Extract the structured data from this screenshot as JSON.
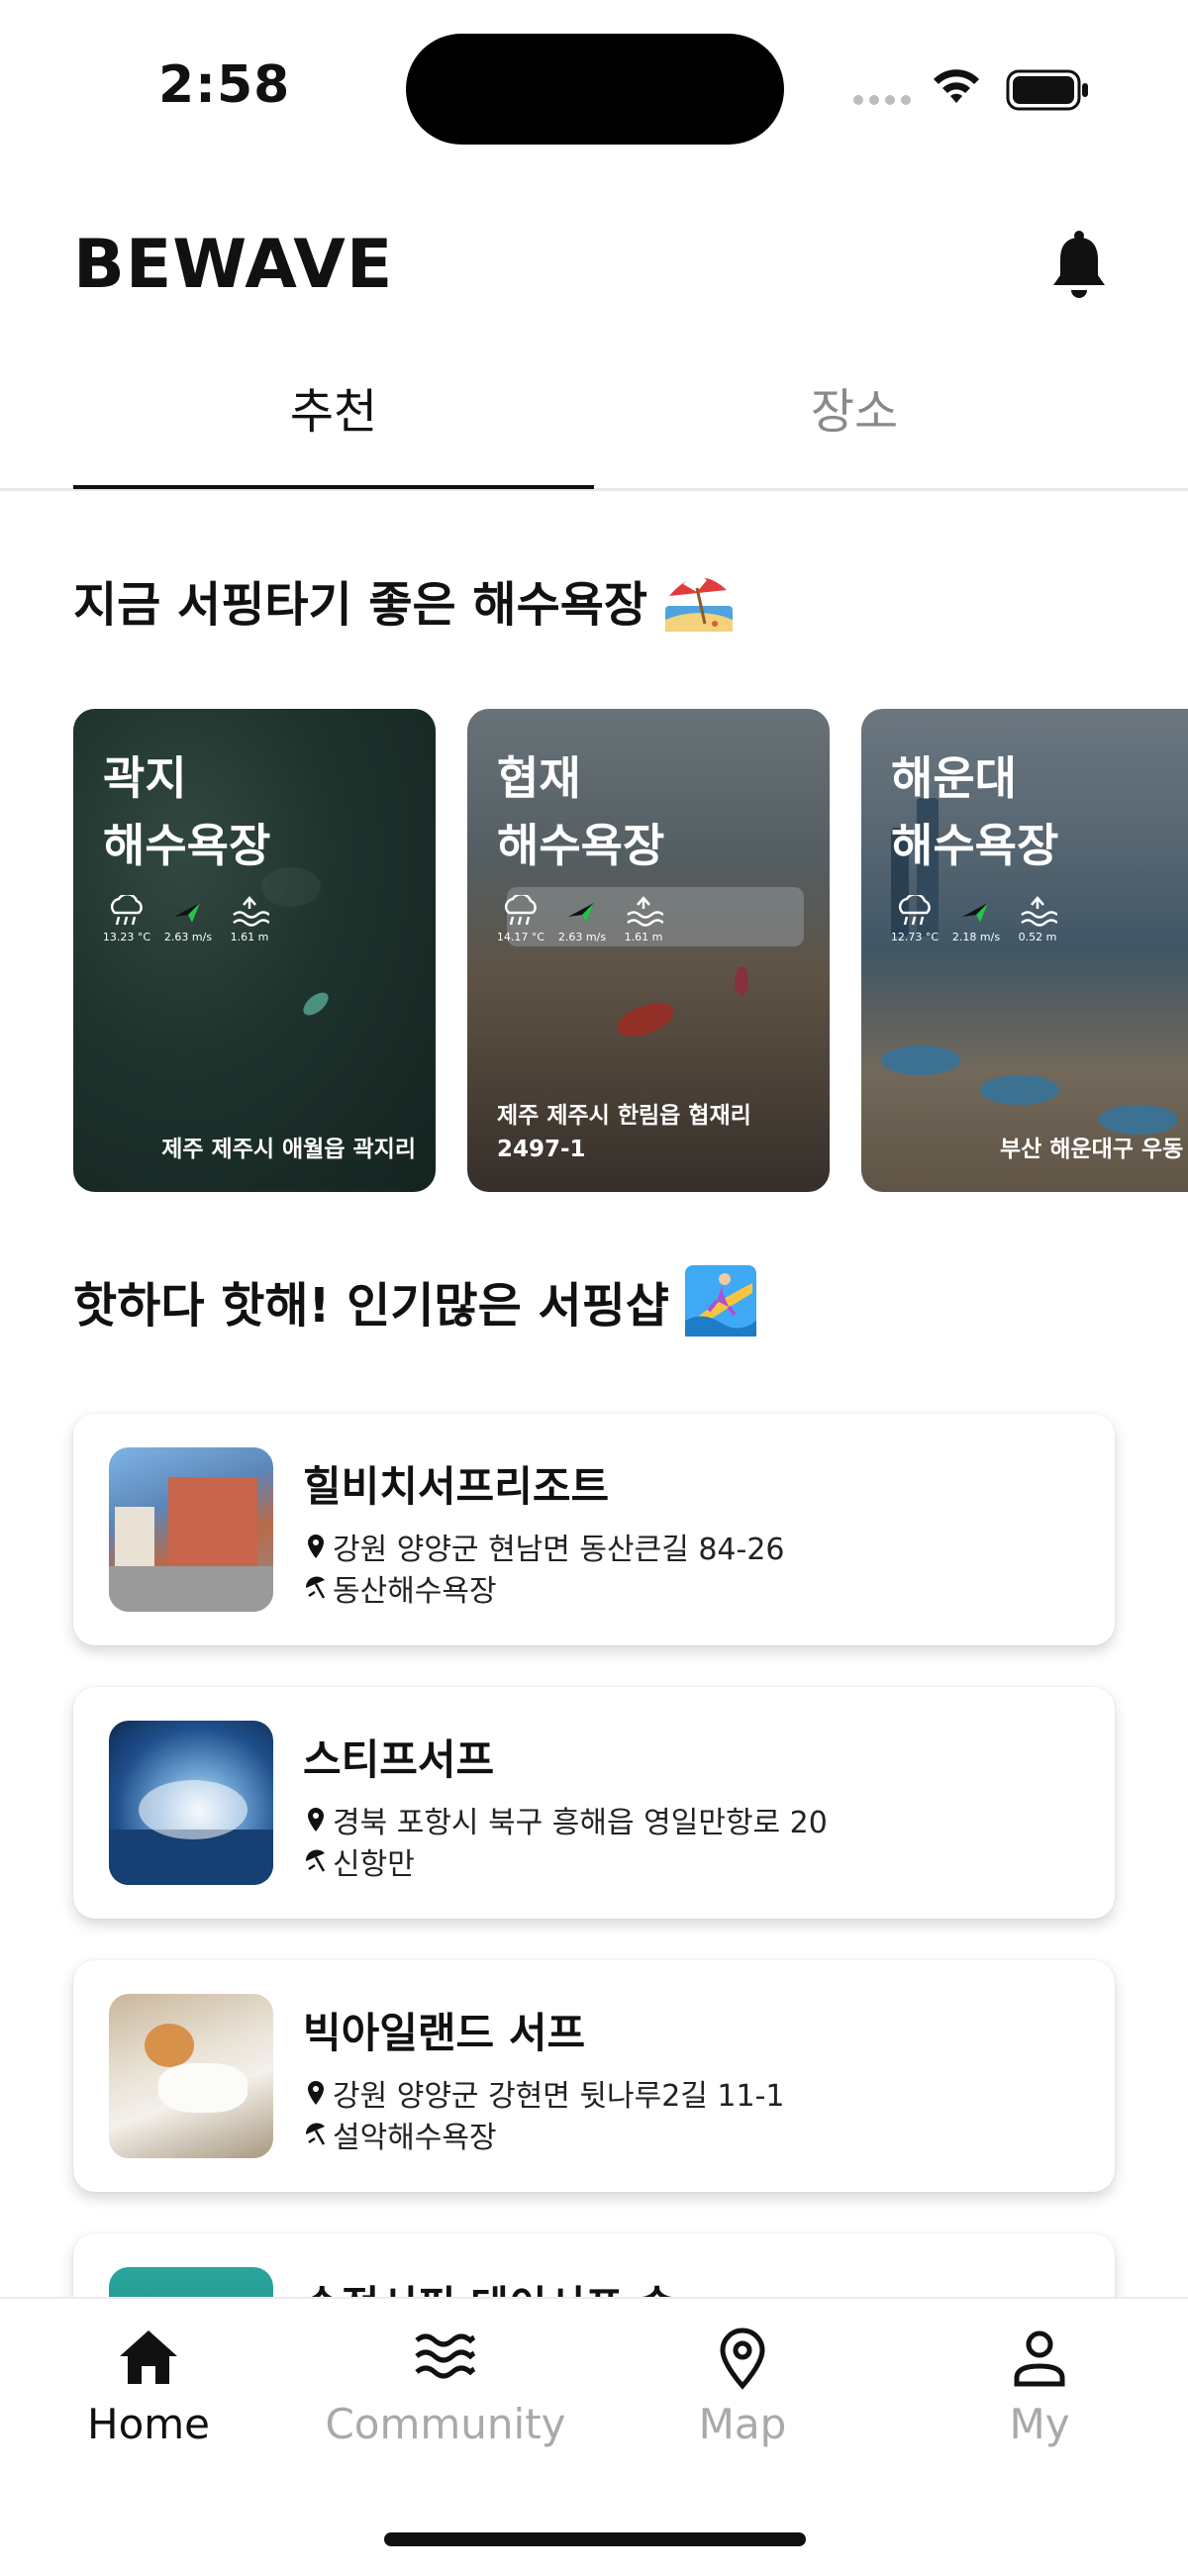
{
  "status_bar": {
    "time": "2:58",
    "icons": [
      "signal-dots-icon",
      "wifi-icon",
      "battery-icon"
    ]
  },
  "header": {
    "title": "BEWAVE",
    "bell_icon": "bell-icon"
  },
  "tabs": [
    {
      "label": "추천",
      "active": true
    },
    {
      "label": "장소",
      "active": false
    }
  ],
  "beach_section": {
    "title": "지금 서핑타기 좋은 해수욕장",
    "emoji_icon": "beach-umbrella-icon",
    "cards": [
      {
        "name_line1": "곽지",
        "name_line2": "해수욕장",
        "temp": "13.23 °C",
        "wind": "2.63 m/s",
        "wave": "1.61 m",
        "address": "제주 제주시 애월읍 곽지리"
      },
      {
        "name_line1": "협재",
        "name_line2": "해수욕장",
        "temp": "14.17 °C",
        "wind": "2.63 m/s",
        "wave": "1.61 m",
        "address": "제주 제주시 한림읍 협재리 2497-1"
      },
      {
        "name_line1": "해운대",
        "name_line2": "해수욕장",
        "temp": "12.73 °C",
        "wind": "2.18 m/s",
        "wave": "0.52 m",
        "address": "부산 해운대구 우동"
      }
    ]
  },
  "shop_section": {
    "title": "핫하다 핫해! 인기많은 서핑샵",
    "emoji_icon": "woman-surfing-icon",
    "shops": [
      {
        "name": "힐비치서프리조트",
        "address": "강원 양양군 현남면 동산큰길 84-26",
        "beach": "동산해수욕장"
      },
      {
        "name": "스티프서프",
        "address": "경북 포항시 북구 흥해읍 영일만항로 20",
        "beach": "신항만"
      },
      {
        "name": "빅아일랜드 서프",
        "address": "강원 양양군 강현면 뒷나루2길 11-1",
        "beach": "설악해수욕장"
      },
      {
        "name": "송정서핑 데이서프 숍",
        "address": "",
        "beach": ""
      }
    ]
  },
  "bottom_nav": [
    {
      "label": "Home",
      "icon": "home-icon",
      "active": true
    },
    {
      "label": "Community",
      "icon": "waves-icon",
      "active": false
    },
    {
      "label": "Map",
      "icon": "map-pin-icon",
      "active": false
    },
    {
      "label": "My",
      "icon": "person-icon",
      "active": false
    }
  ],
  "colors": {
    "text_primary": "#111111",
    "text_inactive": "#a9a9a9",
    "wind_arrow": "#27c24c",
    "background": "#ffffff"
  }
}
